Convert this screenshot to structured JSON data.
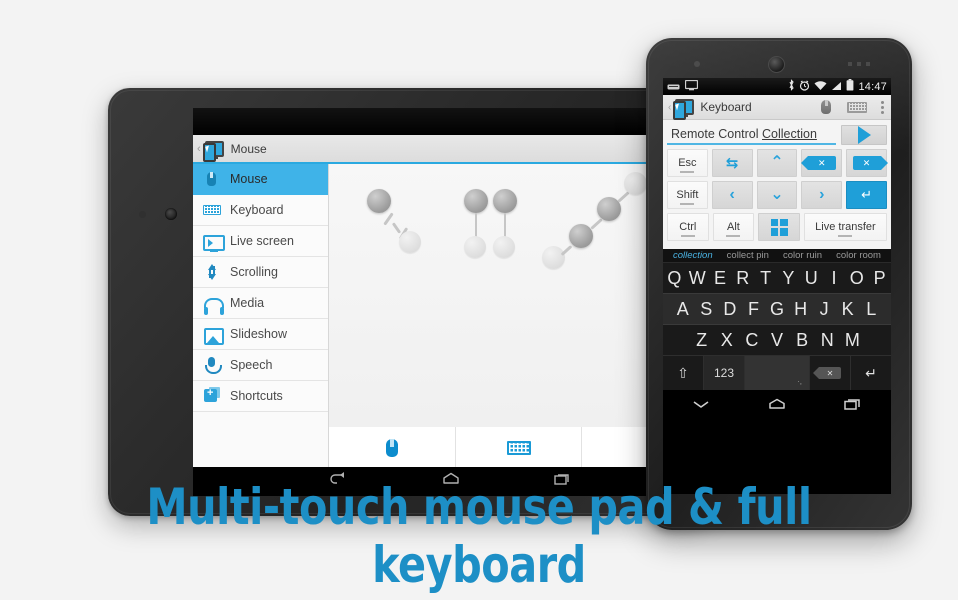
{
  "page": {
    "headline": "Multi-touch mouse pad & full keyboard",
    "headline_color": "#1d8fc6",
    "background_color": "#f3f3f3",
    "accent_color": "#2aa9e0"
  },
  "tablet": {
    "app_bar": {
      "app_icon": "phone-monitor-icon",
      "back_caret": "‹",
      "title": "Mouse"
    },
    "sidebar": {
      "selected": "Mouse",
      "items": [
        {
          "label": "Mouse",
          "icon": "mouse-icon"
        },
        {
          "label": "Keyboard",
          "icon": "keyboard-icon"
        },
        {
          "label": "Live screen",
          "icon": "monitor-icon"
        },
        {
          "label": "Scrolling",
          "icon": "scroll-arrows-icon"
        },
        {
          "label": "Media",
          "icon": "headphones-icon"
        },
        {
          "label": "Slideshow",
          "icon": "image-icon"
        },
        {
          "label": "Speech",
          "icon": "microphone-icon"
        },
        {
          "label": "Shortcuts",
          "icon": "shortcuts-icon"
        }
      ]
    },
    "touchpad": {
      "description": "multi-touch gesture dots",
      "gestures": [
        {
          "name": "single-finger-drag",
          "dots": 2
        },
        {
          "name": "two-finger-swipe-down",
          "dots": 4
        },
        {
          "name": "three-finger-diagonal-swipe",
          "dots": 4
        }
      ]
    },
    "bottom_tabs": [
      {
        "icon": "mouse-icon",
        "selected": true
      },
      {
        "icon": "keyboard-icon",
        "selected": false
      },
      {
        "icon": "blank",
        "selected": false
      }
    ],
    "nav_bar": {
      "back": "back-icon",
      "home": "home-icon",
      "recents": "recents-icon"
    }
  },
  "phone": {
    "status_bar": {
      "left_icons": [
        "keyboard-status-icon",
        "monitor-status-icon"
      ],
      "right_icons": [
        "bluetooth-icon",
        "alarm-icon",
        "wifi-icon",
        "signal-icon",
        "battery-icon"
      ],
      "clock": "14:47"
    },
    "action_bar": {
      "back_caret": "‹",
      "app_icon": "phone-monitor-icon",
      "title": "Keyboard",
      "actions": [
        "mouse-icon",
        "keyboard-icon",
        "overflow-menu-icon"
      ]
    },
    "remote_panel": {
      "text_value": "Remote Control Collection",
      "text_value_plain": "Remote Control ",
      "text_value_underlined": "Collection",
      "send_button": "play-icon",
      "key_rows": [
        [
          {
            "label": "Esc",
            "type": "mod"
          },
          {
            "label": "",
            "type": "icon",
            "icon": "swap-arrows-icon"
          },
          {
            "label": "",
            "type": "icon",
            "icon": "chevron-up-icon"
          },
          {
            "label": "",
            "type": "icon",
            "icon": "delete-forward-icon"
          },
          {
            "label": "",
            "type": "icon",
            "icon": "backspace-icon"
          }
        ],
        [
          {
            "label": "Shift",
            "type": "mod"
          },
          {
            "label": "",
            "type": "icon",
            "icon": "chevron-left-icon"
          },
          {
            "label": "",
            "type": "icon",
            "icon": "chevron-down-icon"
          },
          {
            "label": "",
            "type": "icon",
            "icon": "chevron-right-icon"
          },
          {
            "label": "",
            "type": "icon",
            "icon": "enter-icon"
          }
        ],
        [
          {
            "label": "Ctrl",
            "type": "mod"
          },
          {
            "label": "Alt",
            "type": "mod"
          },
          {
            "label": "",
            "type": "icon",
            "icon": "windows-logo-icon"
          },
          {
            "label": "Live transfer",
            "type": "mod"
          }
        ]
      ]
    },
    "keyboard": {
      "suggestions": [
        "collection",
        "collect pin",
        "color ruin",
        "color room"
      ],
      "active_suggestion": "collection",
      "row1": [
        "Q",
        "W",
        "E",
        "R",
        "T",
        "Y",
        "U",
        "I",
        "O",
        "P"
      ],
      "row2": [
        "A",
        "S",
        "D",
        "F",
        "G",
        "H",
        "J",
        "K",
        "L"
      ],
      "row3": [
        "Z",
        "X",
        "C",
        "V",
        "B",
        "N",
        "M"
      ],
      "row4": {
        "shift": "shift-icon",
        "numbers": "123",
        "space": "",
        "space_hint": "·,",
        "backspace": "backspace-icon",
        "return": "return-icon"
      }
    },
    "nav_bar": {
      "back": "collapse-keyboard-icon",
      "home": "home-icon",
      "recents": "recents-icon"
    }
  }
}
